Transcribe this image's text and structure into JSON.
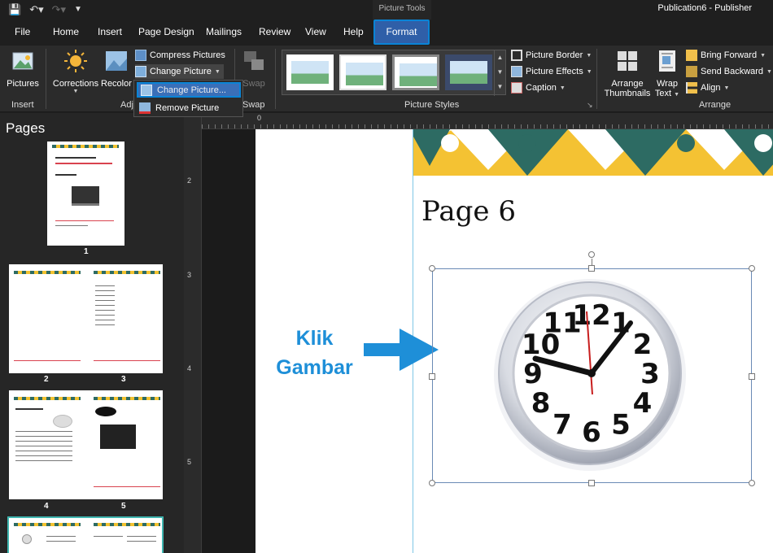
{
  "app": {
    "context_tab_group": "Picture Tools",
    "document_title": "Publication6  -  Publisher"
  },
  "tabs": [
    "File",
    "Home",
    "Insert",
    "Page Design",
    "Mailings",
    "Review",
    "View",
    "Help"
  ],
  "active_tab": "Format",
  "ribbon": {
    "insert_group": {
      "label": "Insert",
      "pictures": "Pictures"
    },
    "adjust_group": {
      "label": "Adj",
      "corrections": "Corrections",
      "recolor": "Recolor",
      "compress": "Compress Pictures",
      "change": "Change Picture"
    },
    "swap_group": {
      "label": "Swap",
      "swap": "Swap"
    },
    "styles_group": {
      "label": "Picture Styles",
      "border": "Picture Border",
      "effects": "Picture Effects",
      "caption": "Caption"
    },
    "arrange_group": {
      "label": "Arrange",
      "arrange_thumbnails_1": "Arrange",
      "arrange_thumbnails_2": "Thumbnails",
      "wrap_text_1": "Wrap",
      "wrap_text_2": "Text",
      "bring_forward": "Bring Forward",
      "send_backward": "Send Backward",
      "align": "Align"
    }
  },
  "change_picture_menu": {
    "change": "Change Picture...",
    "remove": "Remove Picture"
  },
  "pages_pane": {
    "title": "Pages",
    "page_numbers": [
      "1",
      "2",
      "3",
      "4",
      "5"
    ]
  },
  "rulers": {
    "h_zero": "0",
    "v_ticks": [
      "2",
      "3",
      "4",
      "5"
    ]
  },
  "document": {
    "heading": "Page 6",
    "annotation_line1": "Klik",
    "annotation_line2": "Gambar"
  },
  "clock_face": {
    "numerals": [
      "12",
      "1",
      "2",
      "3",
      "4",
      "5",
      "6",
      "7",
      "8",
      "9",
      "10",
      "11"
    ]
  },
  "colors": {
    "accent_blue": "#0a84d6",
    "annotation_blue": "#1e8fd8",
    "band_yellow": "#f4c233",
    "band_green": "#2d6b63"
  }
}
